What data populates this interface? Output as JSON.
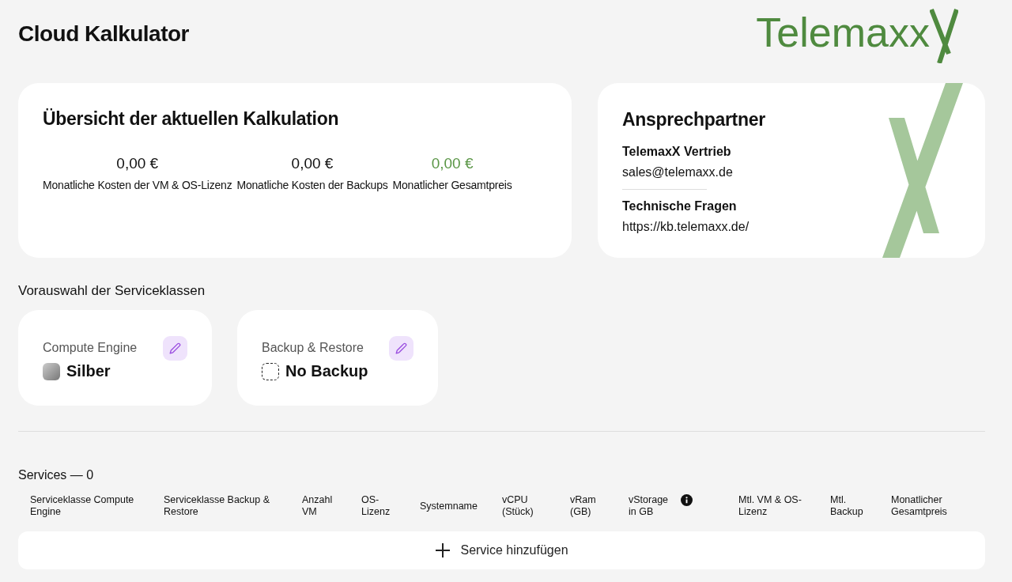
{
  "title": "Cloud Kalkulator",
  "logo": {
    "text": "Telemaxx"
  },
  "overview": {
    "title": "Übersicht der aktuellen Kalkulation",
    "items": [
      {
        "value": "0,00 €",
        "label": "Monatliche Kosten der VM & OS-Lizenz",
        "highlight": false
      },
      {
        "value": "0,00 €",
        "label": "Monatliche Kosten der Backups",
        "highlight": false
      },
      {
        "value": "0,00 €",
        "label": "Monatlicher Gesamtpreis",
        "highlight": true
      }
    ]
  },
  "contact": {
    "title": "Ansprechpartner",
    "groups": [
      {
        "heading": "TelemaxX Vertrieb",
        "text": "sales@telemaxx.de"
      },
      {
        "heading": "Technische Fragen",
        "text": "https://kb.telemaxx.de/"
      }
    ]
  },
  "preselection": {
    "title": "Vorauswahl der Serviceklassen",
    "cards": [
      {
        "label": "Compute Engine",
        "value": "Silber",
        "kind": "silver"
      },
      {
        "label": "Backup & Restore",
        "value": "No Backup",
        "kind": "none"
      }
    ]
  },
  "services": {
    "title": "Services — 0",
    "columns": [
      {
        "label": "Serviceklasse Compute Engine",
        "info": false
      },
      {
        "label": "Serviceklasse Backup & Restore",
        "info": false
      },
      {
        "label": "Anzahl VM",
        "info": false
      },
      {
        "label": "OS-Lizenz",
        "info": false
      },
      {
        "label": "Systemname",
        "info": false
      },
      {
        "label": "vCPU (Stück)",
        "info": false
      },
      {
        "label": "vRam (GB)",
        "info": false
      },
      {
        "label": "vStorage in GB",
        "info": true
      },
      {
        "label": "Mtl. VM & OS-Lizenz",
        "info": false
      },
      {
        "label": "Mtl. Backup",
        "info": false
      },
      {
        "label": "Monatlicher Gesamtpreis",
        "info": false
      }
    ],
    "add_button": "Service hinzufügen"
  }
}
